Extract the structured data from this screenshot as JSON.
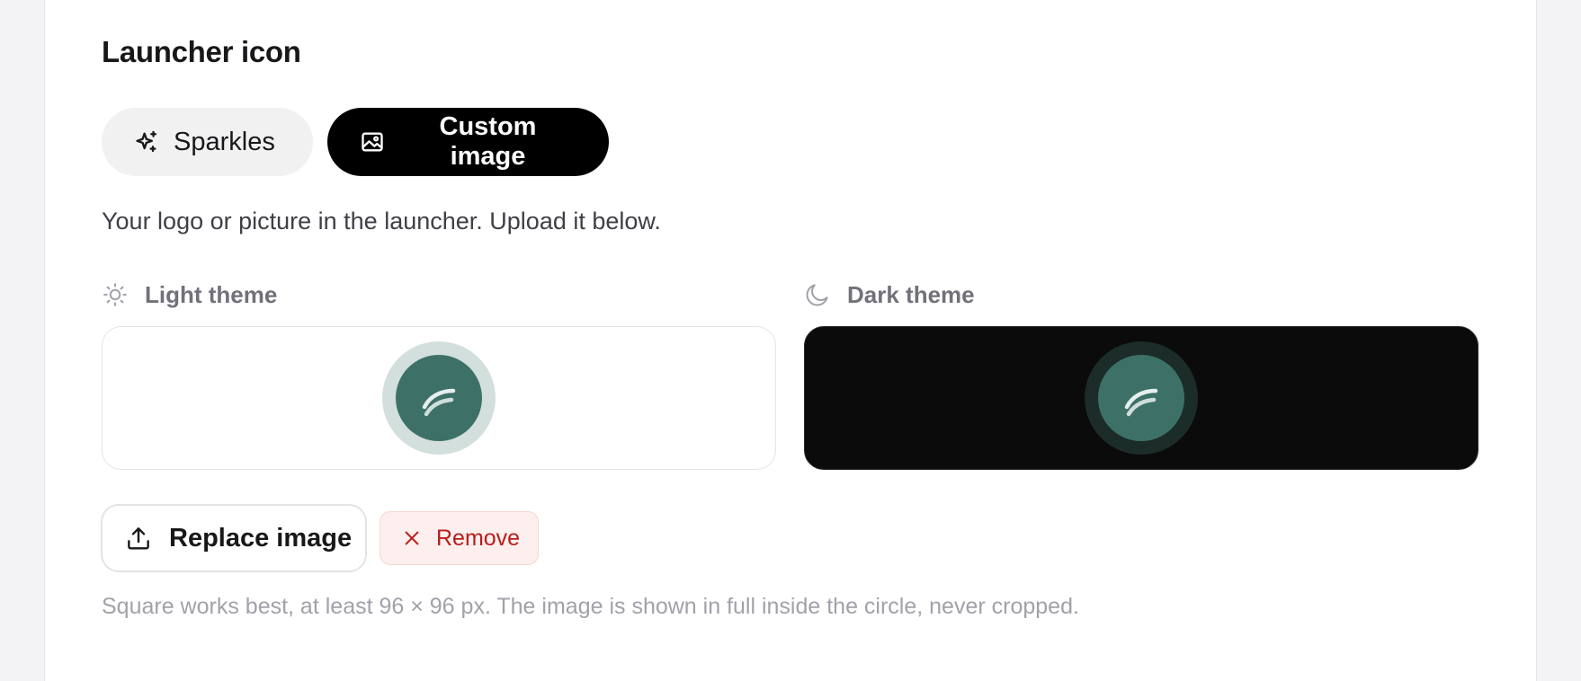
{
  "section": {
    "title": "Launcher icon",
    "description": "Your logo or picture in the launcher. Upload it below.",
    "hint": "Square works best, at least 96 × 96 px. The image is shown in full inside the circle, never cropped."
  },
  "icon_type": {
    "options": [
      {
        "label": "Sparkles",
        "icon": "sparkles-icon",
        "selected": false
      },
      {
        "label": "Custom image",
        "icon": "image-icon",
        "selected": true
      }
    ]
  },
  "previews": {
    "light": {
      "label": "Light theme",
      "icon": "sun-icon",
      "background": "#ffffff"
    },
    "dark": {
      "label": "Dark theme",
      "icon": "moon-icon",
      "background": "#0b0b0c"
    }
  },
  "launcher": {
    "core_color": "#3d7168",
    "ring_color_light": "#d3dfdd",
    "ring_color_dark": "#1b2c29"
  },
  "actions": {
    "replace_label": "Replace image",
    "replace_icon": "upload-icon",
    "remove_label": "Remove",
    "remove_icon": "close-icon",
    "remove_color": "#b91c1c"
  }
}
